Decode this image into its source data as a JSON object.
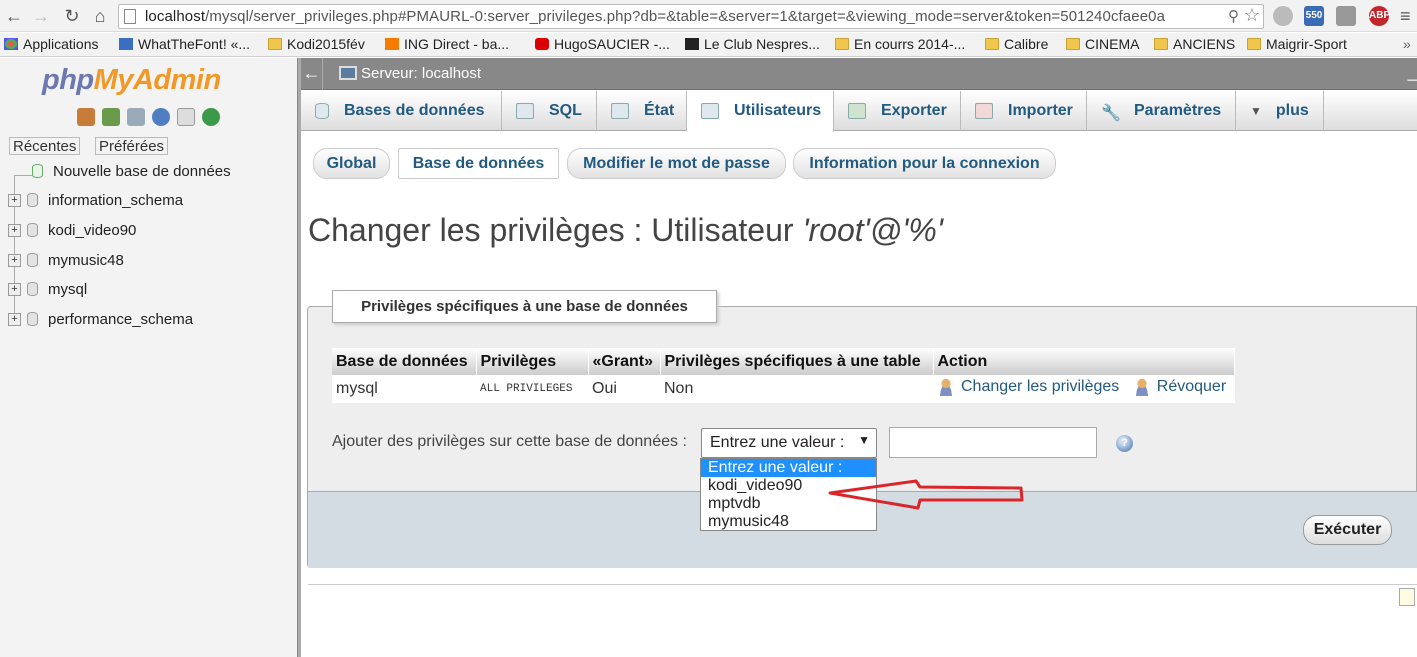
{
  "browser": {
    "url_host": "localhost",
    "url_path": "/mysql/server_privileges.php#PMAURL-0:server_privileges.php?db=&table=&server=1&target=&viewing_mode=server&token=501240cfaee0a",
    "ext_badges": [
      "550",
      "ABP"
    ],
    "bookmarks": [
      "Applications",
      "WhatTheFont! «...",
      "Kodi2015fév",
      "ING Direct - ba...",
      "HugoSAUCIER -...",
      "Le Club Nespres...",
      "En courrs 2014-...",
      "Calibre",
      "CINEMA",
      "ANCIENS",
      "Maigrir-Sport"
    ]
  },
  "nav": {
    "logo_php": "php",
    "logo_my": "MyAdmin",
    "recent_tab": "Récentes",
    "fav_tab": "Préférées",
    "new_db": "Nouvelle base de données",
    "databases": [
      "information_schema",
      "kodi_video90",
      "mymusic48",
      "mysql",
      "performance_schema"
    ]
  },
  "server": {
    "title": "Serveur: localhost"
  },
  "tabs": [
    "Bases de données",
    "SQL",
    "État",
    "Utilisateurs",
    "Exporter",
    "Importer",
    "Paramètres",
    "plus"
  ],
  "active_tab": "Utilisateurs",
  "subtabs": [
    "Global",
    "Base de données",
    "Modifier le mot de passe",
    "Information pour la connexion"
  ],
  "heading": {
    "prefix": "Changer les privilèges : Utilisateur ",
    "user": "'root'@'%'"
  },
  "fieldset": {
    "legend": "Privilèges spécifiques à une base de données",
    "columns": [
      "Base de données",
      "Privilèges",
      "«Grant»",
      "Privilèges spécifiques à une table",
      "Action"
    ],
    "row": {
      "db": "mysql",
      "privs": "ALL PRIVILEGES",
      "grant": "Oui",
      "table_privs": "Non",
      "edit": "Changer les privilèges",
      "revoke": "Révoquer"
    },
    "add_label": "Ajouter des privilèges sur cette base de données :",
    "select_value": "Entrez une valeur :",
    "options": [
      "Entrez une valeur :",
      "kodi_video90",
      "mptvdb",
      "mymusic48"
    ],
    "execute": "Exécuter"
  },
  "colors": {
    "link": "#235a81",
    "annotation_arrow": "#d9262b",
    "selected_option": "#1e90ff"
  }
}
